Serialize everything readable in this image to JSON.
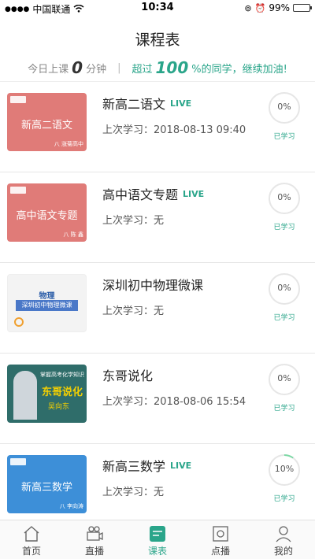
{
  "status": {
    "carrier": "中国联通",
    "time": "10:34",
    "battery": "99%"
  },
  "page": {
    "title": "课程表"
  },
  "summary": {
    "today_label": "今日上课",
    "minutes": "0",
    "minutes_unit": "分钟",
    "beyond_label": "超过",
    "percent": "100",
    "percent_suffix": "%的同学，继续加油!"
  },
  "courses": [
    {
      "name": "新高二语文",
      "live": "LIVE",
      "last": "上次学习：2018-08-13  09:40",
      "progress": "0%",
      "learned": "已学习",
      "thumb_title": "新高二语文",
      "thumb_teacher": "八 涨菊高中",
      "thumb_color": "#e07b78"
    },
    {
      "name": "高中语文专题",
      "live": "LIVE",
      "last": "上次学习：无",
      "progress": "0%",
      "learned": "已学习",
      "thumb_title": "高中语文专题",
      "thumb_teacher": "八 陈 鑫",
      "thumb_color": "#e07b78"
    },
    {
      "name": "深圳初中物理微课",
      "live": "",
      "last": "上次学习：无",
      "progress": "0%",
      "learned": "已学习",
      "thumb_title": "深圳初中物理微课",
      "thumb_sub": "物理",
      "thumb_color": "#f3f3f3"
    },
    {
      "name": "东哥说化",
      "live": "",
      "last": "上次学习：2018-08-06  15:54",
      "progress": "0%",
      "learned": "已学习",
      "thumb_title": "东哥说化",
      "thumb_sub": "掌握高考化学知识",
      "thumb_teacher": "吴向东",
      "thumb_color": "#2f6d6a"
    },
    {
      "name": "新高三数学",
      "live": "LIVE",
      "last": "上次学习：无",
      "progress": "10%",
      "learned": "已学习",
      "thumb_title": "新高三数学",
      "thumb_teacher": "八 李向涛",
      "thumb_color": "#3d8fd8"
    }
  ],
  "tabs": [
    {
      "label": "首页",
      "icon": "home-icon"
    },
    {
      "label": "直播",
      "icon": "live-camera-icon"
    },
    {
      "label": "课表",
      "icon": "schedule-icon"
    },
    {
      "label": "点播",
      "icon": "vod-icon"
    },
    {
      "label": "我的",
      "icon": "profile-icon"
    }
  ],
  "colors": {
    "accent": "#2aa58a",
    "ring": "#e6e6e6",
    "progress_ring": "#7ed9a6"
  }
}
